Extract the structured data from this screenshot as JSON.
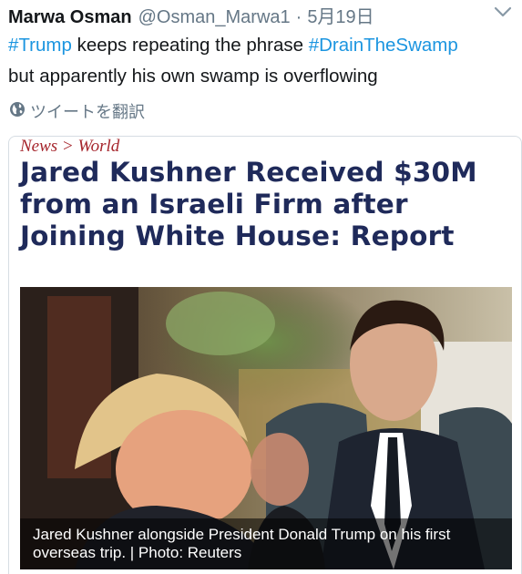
{
  "tweet": {
    "author_name": "Marwa Osman",
    "author_handle": "@Osman_Marwa1",
    "separator": "·",
    "date": "5月19日",
    "hashtag_trump": "#Trump",
    "text_part1": " keeps repeating the phrase ",
    "hashtag_drain": "#DrainTheSwamp",
    "text_part2": "but apparently his own swamp is overflowing",
    "translate_label": "ツイートを翻訳",
    "link_color": "#1b95e0"
  },
  "card": {
    "breadcrumb": "News > World",
    "headline": "Jared Kushner Received $30M from an Israeli Firm after Joining White House: Report",
    "caption": "Jared Kushner alongside President Donald Trump on his first overseas trip. | Photo: Reuters",
    "headline_color": "#1f2a5a",
    "breadcrumb_color": "#a6262d"
  },
  "icons": {
    "caret": "chevron-down-icon",
    "translate": "globe-icon"
  }
}
